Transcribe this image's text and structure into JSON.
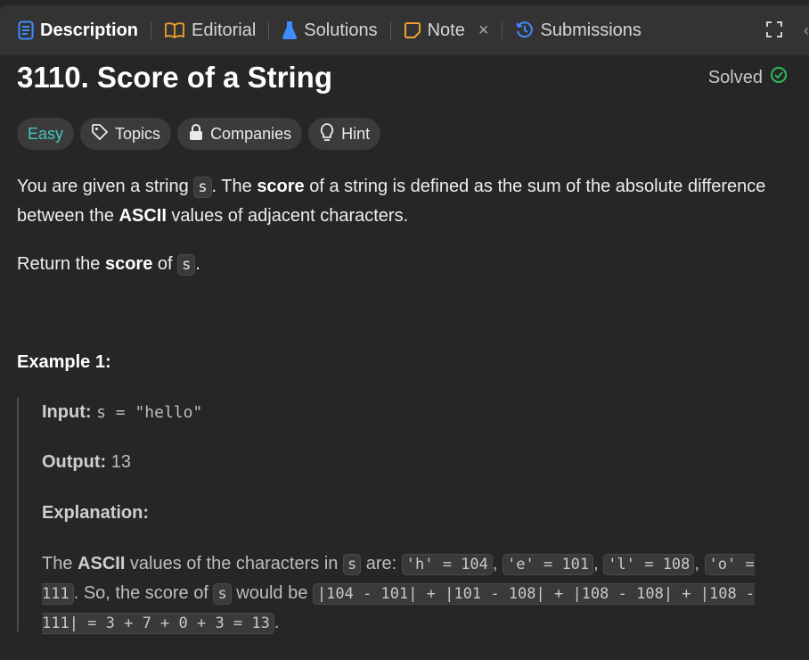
{
  "tabs": [
    {
      "label": "Description",
      "icon": "document-icon",
      "color": "#3f8cff"
    },
    {
      "label": "Editorial",
      "icon": "book-icon",
      "color": "#f0a02a"
    },
    {
      "label": "Solutions",
      "icon": "flask-icon",
      "color": "#3f8cff"
    },
    {
      "label": "Note",
      "icon": "note-icon",
      "color": "#f0a02a"
    },
    {
      "label": "Submissions",
      "icon": "history-icon",
      "color": "#3f8cff"
    }
  ],
  "note_close": "×",
  "problem": {
    "title": "3110. Score of a String",
    "status": "Solved",
    "status_color": "#2cbb5d"
  },
  "chips": {
    "difficulty": "Easy",
    "topics": "Topics",
    "companies": "Companies",
    "hint": "Hint"
  },
  "description": {
    "p1_a": "You are given a string ",
    "p1_code": "s",
    "p1_b": ". The ",
    "p1_bold1": "score",
    "p1_c": " of a string is defined as the sum of the absolute difference between the ",
    "p1_bold2": "ASCII",
    "p1_d": " values of adjacent characters.",
    "p2_a": "Return the ",
    "p2_bold": "score",
    "p2_b": " of ",
    "p2_code": "s",
    "p2_c": "."
  },
  "example": {
    "title": "Example 1:",
    "input_label": "Input:",
    "input_value": "s = \"hello\"",
    "output_label": "Output:",
    "output_value": "13",
    "explanation_label": "Explanation:",
    "expl_a": "The ",
    "expl_bold": "ASCII",
    "expl_b": " values of the characters in ",
    "expl_code1": "s",
    "expl_c": " are: ",
    "expl_code2": "'h' = 104",
    "expl_sep1": ", ",
    "expl_code3": "'e' = 101",
    "expl_sep2": ", ",
    "expl_code4": "'l' = 108",
    "expl_sep3": ", ",
    "expl_code5": "'o' = 111",
    "expl_d": ". So, the score of ",
    "expl_code6": "s",
    "expl_e": " would be ",
    "expl_code7": "|104 - 101| + |101 - 108| + |108 - 108| + |108 - 111| = 3 + 7 + 0 + 3 = 13",
    "expl_f": "."
  }
}
